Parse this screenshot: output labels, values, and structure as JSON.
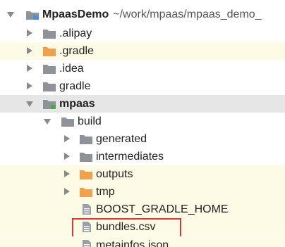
{
  "tree": {
    "root": {
      "label": "MpaasDemo",
      "path": "~/work/mpaas/mpaas_demo_"
    },
    "items": [
      {
        "label": ".alipay"
      },
      {
        "label": ".gradle"
      },
      {
        "label": ".idea"
      },
      {
        "label": "gradle"
      },
      {
        "label": "mpaas"
      },
      {
        "label": "build"
      },
      {
        "label": "generated"
      },
      {
        "label": "intermediates"
      },
      {
        "label": "outputs"
      },
      {
        "label": "tmp"
      },
      {
        "label": "BOOST_GRADLE_HOME"
      },
      {
        "label": "bundles.csv"
      },
      {
        "label": "metainfos.json"
      }
    ]
  },
  "colors": {
    "folder_gray": "#8e9399",
    "folder_orange": "#f1a14b",
    "module_blue": "#4a90d9",
    "file_gray": "#9aa0a6",
    "highlight_red": "#d43a3a",
    "selected_bg": "#e6e6e6",
    "excluded_bg": "#fdfbe6"
  },
  "icons": {
    "folder": "folder-icon",
    "orange_folder": "excluded-folder-icon",
    "module": "module-icon",
    "file": "text-file-icon"
  }
}
